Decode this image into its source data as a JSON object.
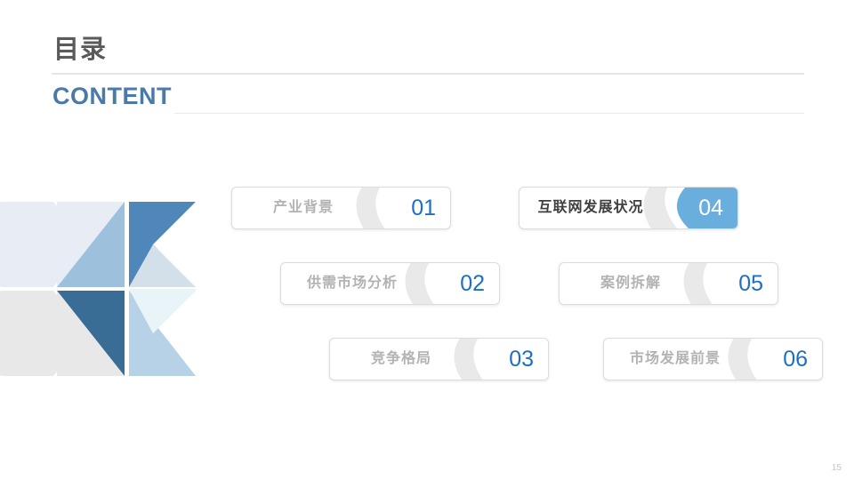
{
  "header": {
    "title_cn": "目录",
    "title_en": "CONTENT"
  },
  "colors": {
    "accent_blue": "#1c6fc4",
    "highlight_blue": "#6aaede",
    "title_en_blue": "#4a7ba8",
    "title_cn_gray": "#5a5a5a",
    "label_gray": "#b3b3b3",
    "swoosh_gray": "#e9e9e9",
    "deco_pale_blue": "#e7ecf5",
    "deco_light_gray": "#e8e8e8",
    "deco_mid_blue": "#9dc1dc",
    "deco_strong_blue": "#4f87bb",
    "deco_deep_blue": "#3a6d96",
    "deco_soft_blue": "#d3e0ea",
    "deco_very_pale": "#e8f4f8",
    "deco_pale_blue2": "#b7d2e6"
  },
  "cards": [
    {
      "id": "card-01",
      "number": "01",
      "label": "产业背景",
      "active": false
    },
    {
      "id": "card-02",
      "number": "02",
      "label": "供需市场分析",
      "active": false
    },
    {
      "id": "card-03",
      "number": "03",
      "label": "竞争格局",
      "active": false
    },
    {
      "id": "card-04",
      "number": "04",
      "label": "互联网发展状况",
      "active": true
    },
    {
      "id": "card-05",
      "number": "05",
      "label": "案例拆解",
      "active": false
    },
    {
      "id": "card-06",
      "number": "06",
      "label": "市场发展前景",
      "active": false
    }
  ],
  "footer": {
    "page_number": "15"
  },
  "decoration": {
    "name": "geometric-arrow-pattern"
  }
}
